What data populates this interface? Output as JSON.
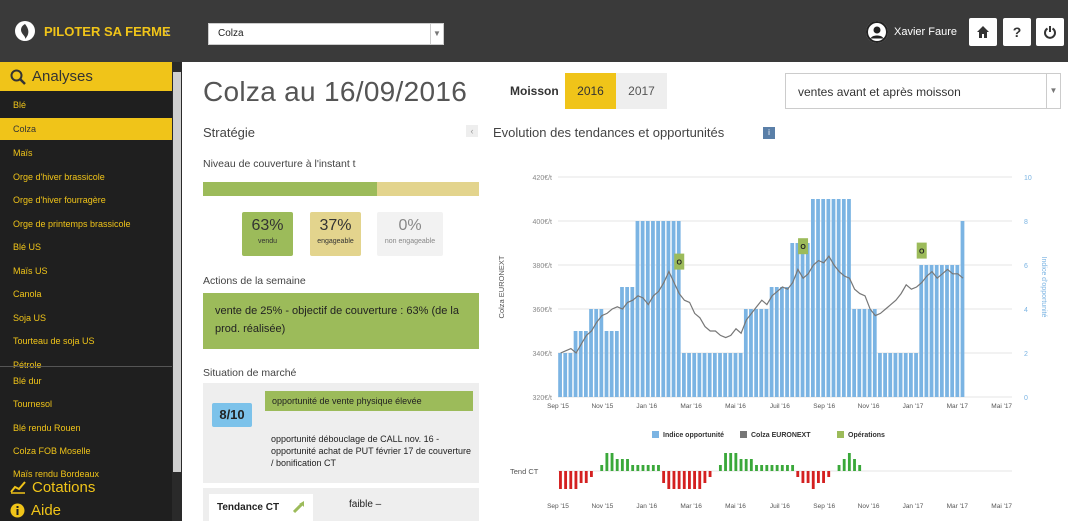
{
  "topbar": {
    "brand_a": "PILOTER",
    "brand_b": " SA FERME",
    "collapse": "‹",
    "crop_select": "Colza",
    "user_name": "Xavier Faure",
    "home_icon": "home-icon",
    "help_label": "?",
    "power_icon": "power-icon"
  },
  "sidebar": {
    "analyses_label": "Analyses",
    "items": [
      "Blé",
      "Colza",
      "Maïs",
      "Orge d'hiver brassicole",
      "Orge d'hiver fourragère",
      "Orge de printemps brassicole",
      "Blé US",
      "Maïs US",
      "Canola",
      "Soja US",
      "Tourteau de soja US",
      "Pétrole",
      "Blé dur",
      "Tournesol",
      "Blé rendu Rouen",
      "Colza FOB Moselle",
      "Maïs rendu Bordeaux"
    ],
    "active_index": 1,
    "cotations_label": "Cotations",
    "aide_label": "Aide"
  },
  "main": {
    "title": "Colza au 16/09/2016",
    "moisson_label": "Moisson",
    "years": [
      "2016",
      "2017"
    ],
    "active_year": "2016",
    "sales_select": "ventes avant et après moisson"
  },
  "strategy": {
    "title": "Stratégie",
    "coverage_label": "Niveau de couverture à l'instant t",
    "coverage_sold_fraction": 0.63,
    "boxes": [
      {
        "pct": "63%",
        "label": "vendu",
        "color": "#9cbb5a"
      },
      {
        "pct": "37%",
        "label": "engageable",
        "color": "#e3d48d"
      },
      {
        "pct": "0%",
        "label": "non engageable",
        "color": "#f2f2f2"
      }
    ],
    "actions_title": "Actions de la semaine",
    "action_text": "vente de 25% - objectif de couverture : 63% (de la prod. réalisée)",
    "market_title": "Situation de marché",
    "score": "8/10",
    "opportunity_1": "opportunité de vente physique élevée",
    "opportunity_2": "opportunité débouclage de CALL nov. 16 - opportunité achat de PUT février 17 de couverture / bonification CT",
    "trend_label": "Tendance CT",
    "trend_value": "faible  –"
  },
  "chart_title": "Evolution des tendances et opportunités",
  "chart_data": {
    "type": "bar+line",
    "y_left_label": "Colza EURONEXT",
    "y_right_label": "Indice d'opportunité",
    "y_left_ticks": [
      "320€/t",
      "340€/t",
      "360€/t",
      "380€/t",
      "400€/t",
      "420€/t"
    ],
    "y_left_range": [
      320,
      420
    ],
    "y_right_ticks": [
      "0",
      "2",
      "4",
      "6",
      "8",
      "10"
    ],
    "y_right_range": [
      0,
      10
    ],
    "x_ticks": [
      "Sep '15",
      "Nov '15",
      "Jan '16",
      "Mar '16",
      "Mai '16",
      "Juil '16",
      "Sep '16",
      "Nov '16",
      "Jan '17",
      "Mar '17",
      "Mai '17"
    ],
    "x_range_weeks": [
      0,
      88
    ],
    "legend": [
      "Indice opportunité",
      "Colza EURONEXT",
      "Opérations"
    ],
    "series_colors": {
      "bars": "#7bb4e3",
      "line": "#777777",
      "ops": "#9cbb5a"
    },
    "opportunity_index": [
      2,
      2,
      2,
      3,
      3,
      3,
      4,
      4,
      4,
      3,
      3,
      3,
      5,
      5,
      5,
      8,
      8,
      8,
      8,
      8,
      8,
      8,
      8,
      8,
      2,
      2,
      2,
      2,
      2,
      2,
      2,
      2,
      2,
      2,
      2,
      2,
      4,
      4,
      4,
      4,
      4,
      5,
      5,
      5,
      5,
      7,
      7,
      7,
      7,
      9,
      9,
      9,
      9,
      9,
      9,
      9,
      9,
      4,
      4,
      4,
      4,
      4,
      2,
      2,
      2,
      2,
      2,
      2,
      2,
      2,
      6,
      6,
      6,
      6,
      6,
      6,
      6,
      6,
      8
    ],
    "colza_price": [
      340,
      341,
      342,
      340,
      344,
      348,
      350,
      354,
      357,
      358,
      360,
      361,
      360,
      363,
      364,
      366,
      365,
      362,
      366,
      368,
      372,
      377,
      372,
      367,
      364,
      363,
      358,
      356,
      352,
      350,
      350,
      348,
      347,
      348,
      351,
      349,
      355,
      358,
      361,
      364,
      362,
      366,
      368,
      370,
      369,
      372,
      378,
      374,
      376,
      380,
      382,
      381,
      384,
      380,
      377,
      375,
      374,
      369,
      367,
      366,
      360,
      357,
      358,
      360,
      362,
      364,
      367,
      371,
      369,
      370,
      372,
      375,
      377,
      374,
      376,
      378,
      376,
      376,
      374
    ],
    "operations": [
      {
        "week": 23,
        "label": "O"
      },
      {
        "week": 47,
        "label": "O"
      },
      {
        "week": 70,
        "label": "O"
      }
    ],
    "short_term_trend_label": "Tend CT",
    "short_term_trend": [
      -3,
      -3,
      -3,
      -3,
      -2,
      -2,
      -1,
      0,
      1,
      3,
      3,
      2,
      2,
      2,
      1,
      1,
      1,
      1,
      1,
      1,
      -2,
      -3,
      -3,
      -3,
      -3,
      -3,
      -3,
      -3,
      -2,
      -1,
      0,
      1,
      3,
      3,
      3,
      2,
      2,
      2,
      1,
      1,
      1,
      1,
      1,
      1,
      1,
      1,
      -1,
      -2,
      -2,
      -3,
      -2,
      -2,
      -1,
      0,
      1,
      2,
      3,
      2,
      1
    ]
  }
}
